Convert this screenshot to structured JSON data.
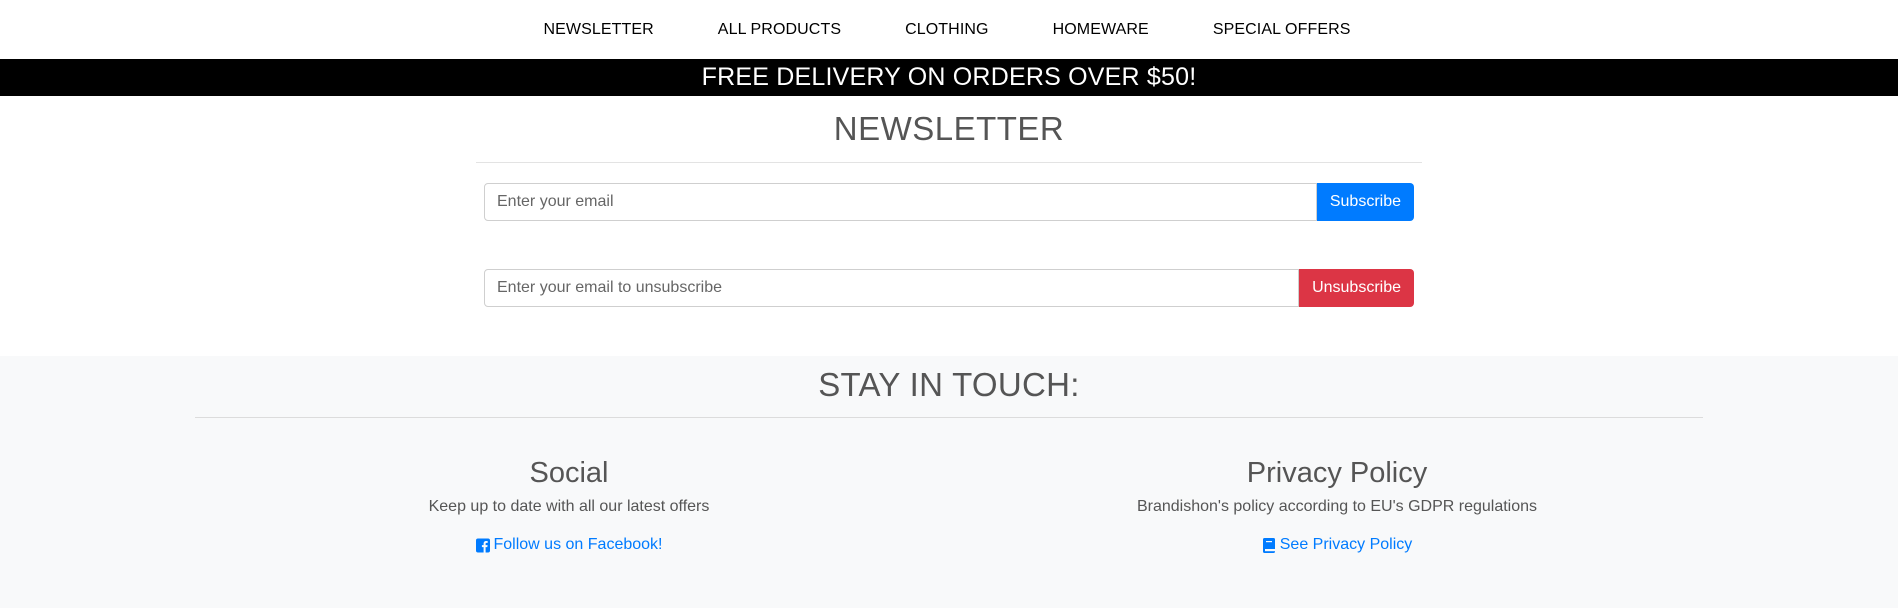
{
  "nav": {
    "items": [
      {
        "label": "NEWSLETTER"
      },
      {
        "label": "ALL PRODUCTS"
      },
      {
        "label": "CLOTHING"
      },
      {
        "label": "HOMEWARE"
      },
      {
        "label": "SPECIAL OFFERS"
      }
    ]
  },
  "banner": {
    "text": "FREE DELIVERY ON ORDERS OVER $50!"
  },
  "newsletter": {
    "title": "NEWSLETTER",
    "subscribe": {
      "placeholder": "Enter your email",
      "button_label": "Subscribe"
    },
    "unsubscribe": {
      "placeholder": "Enter your email to unsubscribe",
      "button_label": "Unsubscribe"
    }
  },
  "footer": {
    "title": "STAY IN TOUCH:",
    "social": {
      "heading": "Social",
      "text": "Keep up to date with all our latest offers",
      "link_label": "Follow us on Facebook!",
      "icon": "facebook-square-icon"
    },
    "privacy": {
      "heading": "Privacy Policy",
      "text": "Brandishon's policy according to EU's GDPR regulations",
      "link_label": "See Privacy Policy",
      "icon": "book-icon"
    }
  },
  "colors": {
    "primary": "#007bff",
    "danger": "#dc3545",
    "banner_bg": "#000000",
    "footer_bg": "#f8f9fa"
  }
}
